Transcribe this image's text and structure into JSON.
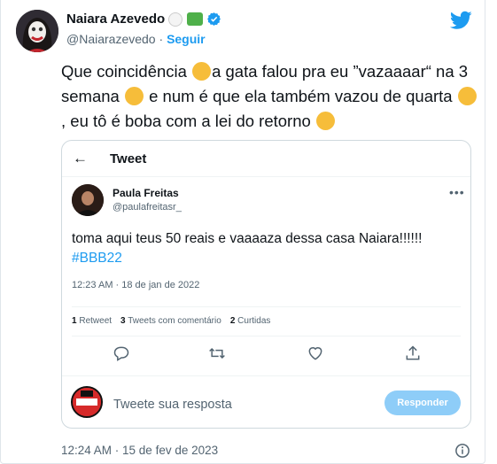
{
  "author": {
    "name": "Naiara Azevedo",
    "handle": "@Naiarazevedo",
    "separator": "·",
    "follow_label": "Seguir",
    "name_emojis": [
      "clown-face-emoji",
      "money-with-wings-emoji"
    ],
    "verified": true
  },
  "tweet": {
    "text_parts": {
      "p1": "Que coincidência ",
      "p2": "a gata falou pra eu ”vazaaaar“ na 3 semana ",
      "p3": " e num é que ela também vazou  de quarta ",
      "p4": " ,  eu tô é boba com a lei do retorno "
    },
    "emojis": [
      "shushing-face-emoji",
      "slightly-frowning-face-emoji",
      "thinking-face-emoji",
      "face-with-hand-over-mouth-emoji"
    ],
    "timestamp": "12:24 AM · 15 de fev de 2023"
  },
  "embedded": {
    "header_title": "Tweet",
    "back_icon": "arrow-left-icon",
    "author_name": "Paula Freitas",
    "author_handle": "@paulafreitasr_",
    "more_icon": "more-horizontal-icon",
    "text": "toma aqui teus 50 reais e vaaaaza dessa casa Naiara!!!!!! ",
    "hashtag": "#BBB22",
    "timestamp": "12:23 AM · 18 de jan de 2022",
    "stats": [
      {
        "count": "1",
        "label": "Retweet"
      },
      {
        "count": "3",
        "label": "Tweets com comentário"
      },
      {
        "count": "2",
        "label": "Curtidas"
      }
    ],
    "actions": [
      "reply-icon",
      "retweet-icon",
      "like-icon",
      "share-icon"
    ],
    "reply_placeholder": "Tweete sua resposta",
    "reply_button": "Responder"
  },
  "colors": {
    "accent": "#1d9bf0",
    "reply_button": "#8ecdf8",
    "secondary_text": "#536471"
  }
}
